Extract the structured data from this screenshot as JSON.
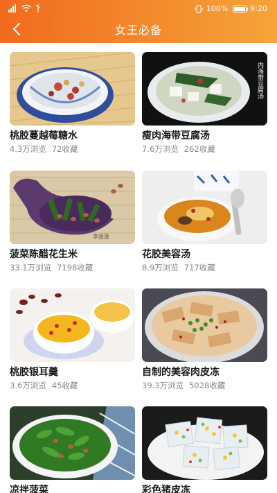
{
  "status_bar": {
    "battery_percent": "100%",
    "battery_level": 1.0,
    "time": "9:20"
  },
  "header": {
    "title": "女王必备"
  },
  "colors": {
    "header_gradient_start": "#f26a1f",
    "header_gradient_end": "#f6a43a",
    "title_text": "#1a1a1a",
    "stats_text": "#888888"
  },
  "recipes": [
    {
      "title": "桃胶蔓越莓糖水",
      "views": "4.3万浏览",
      "favorites": "72收藏"
    },
    {
      "title": "瘦肉海带豆腐汤",
      "views": "7.6万浏览",
      "favorites": "262收藏"
    },
    {
      "title": "菠菜陈醋花生米",
      "views": "33.1万浏览",
      "favorites": "7198收藏"
    },
    {
      "title": "花胶美容汤",
      "views": "8.9万浏览",
      "favorites": "717收藏"
    },
    {
      "title": "桃胶银耳羹",
      "views": "3.6万浏览",
      "favorites": "45收藏"
    },
    {
      "title": "自制的美容肉皮冻",
      "views": "39.3万浏览",
      "favorites": "5028收藏"
    },
    {
      "title": "凉拌菠菜",
      "views": "",
      "favorites": ""
    },
    {
      "title": "彩色猪皮冻",
      "views": "",
      "favorites": ""
    }
  ],
  "thumb_watermarks": {
    "soup_right": "内海带豆腐汤",
    "spinach_left": "李蓬蓬"
  }
}
